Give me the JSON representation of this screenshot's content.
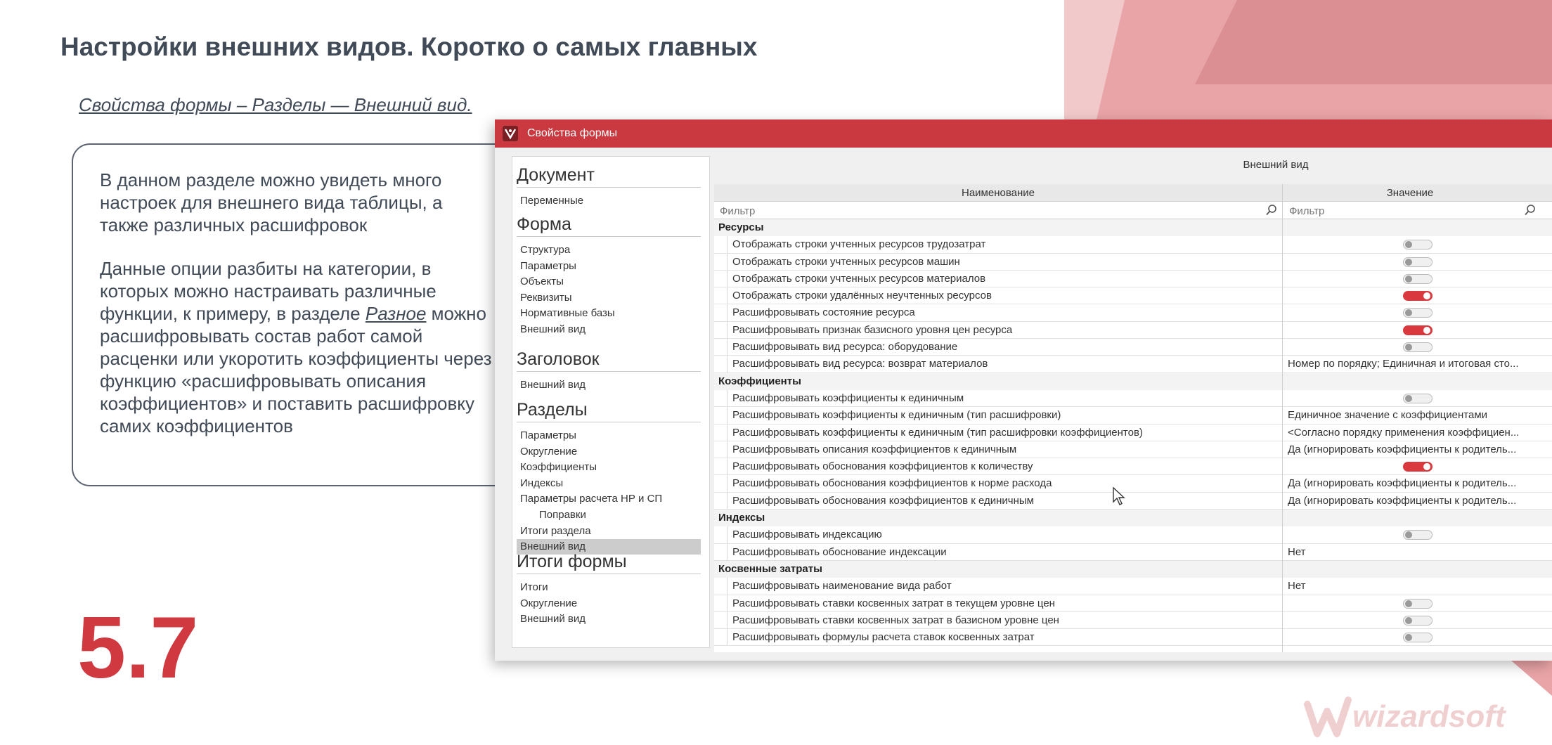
{
  "slide": {
    "title": "Настройки внешних видов. Коротко о самых главных",
    "breadcrumb": "Свойства формы – Разделы — Внешний вид.",
    "info_p1": "В данном разделе можно увидеть много настроек для внешнего вида таблицы, а также различных расшифровок",
    "info_p2_before": "Данные опции разбиты на категории, в которых можно настраивать различные функции, к примеру, в разделе ",
    "info_p2_link": "Разное",
    "info_p2_after": " можно расшифровывать состав работ самой расценки или укоротить коэффициенты через функцию «расшифровывать описания коэффициентов» и поставить расшифровку самих коэффициентов",
    "section_number": "5.7",
    "logo_text": "wizardsoft",
    "colors": {
      "accent": "#d0393f",
      "titlebar": "#c9393f",
      "text": "#414a57"
    }
  },
  "window": {
    "title": "Свойства формы",
    "icon": "app-icon",
    "panel_heading": "Внешний вид"
  },
  "nav": {
    "sections": [
      {
        "label": "Документ",
        "items": [
          "Переменные"
        ]
      },
      {
        "label": "Форма",
        "items": [
          "Структура",
          "Параметры",
          "Объекты",
          "Реквизиты",
          "Нормативные базы",
          "Внешний вид"
        ]
      },
      {
        "label": "Заголовок",
        "items": [
          "Внешний вид"
        ]
      },
      {
        "label": "Разделы",
        "items": [
          "Параметры",
          "Округление",
          "Коэффициенты",
          "Индексы",
          "Параметры расчета НР и СП",
          "Поправки",
          "Итоги раздела",
          "Внешний вид"
        ]
      },
      {
        "label": "Итоги формы",
        "items": [
          "Итоги",
          "Округление",
          "Внешний вид"
        ]
      }
    ],
    "selected": "Разделы / Внешний вид"
  },
  "grid": {
    "col_name": "Наименование",
    "col_value": "Значение",
    "filter_placeholder": "Фильтр",
    "categories": [
      {
        "name": "Ресурсы",
        "rows": [
          {
            "name": "Отображать строки учтенных ресурсов трудозатрат",
            "toggle": false
          },
          {
            "name": "Отображать строки учтенных ресурсов машин",
            "toggle": false
          },
          {
            "name": "Отображать строки учтенных ресурсов материалов",
            "toggle": false
          },
          {
            "name": "Отображать строки удалённых неучтенных ресурсов",
            "toggle": true
          },
          {
            "name": "Расшифровывать состояние ресурса",
            "toggle": false
          },
          {
            "name": "Расшифровывать признак базисного уровня цен ресурса",
            "toggle": true
          },
          {
            "name": "Расшифровывать вид ресурса: оборудование",
            "toggle": false
          },
          {
            "name": "Расшифровывать вид ресурса: возврат материалов",
            "value": "Номер по порядку; Единичная и итоговая сто..."
          }
        ]
      },
      {
        "name": "Коэффициенты",
        "rows": [
          {
            "name": "Расшифровывать коэффициенты к единичным",
            "toggle": false
          },
          {
            "name": "Расшифровывать коэффициенты к единичным (тип расшифровки)",
            "value": "Единичное значение с коэффициентами"
          },
          {
            "name": "Расшифровывать коэффициенты к единичным (тип расшифровки коэффициентов)",
            "value": "<Согласно порядку применения коэффициен..."
          },
          {
            "name": "Расшифровывать описания коэффициентов к единичным",
            "value": "Да (игнорировать коэффициенты к родитель..."
          },
          {
            "name": "Расшифровывать обоснования коэффициентов к количеству",
            "toggle": true
          },
          {
            "name": "Расшифровывать обоснования коэффициентов к норме расхода",
            "value": "Да (игнорировать коэффициенты к родитель..."
          },
          {
            "name": "Расшифровывать обоснования коэффициентов к единичным",
            "value": "Да (игнорировать коэффициенты к родитель..."
          }
        ]
      },
      {
        "name": "Индексы",
        "rows": [
          {
            "name": "Расшифровывать индексацию",
            "toggle": false
          },
          {
            "name": "Расшифровывать обоснование индексации",
            "value": "Нет"
          }
        ]
      },
      {
        "name": "Косвенные затраты",
        "rows": [
          {
            "name": "Расшифровывать наименование вида работ",
            "value": "Нет"
          },
          {
            "name": "Расшифровывать ставки косвенных затрат в текущем уровне цен",
            "toggle": false
          },
          {
            "name": "Расшифровывать ставки косвенных затрат в базисном уровне цен",
            "toggle": false
          },
          {
            "name": "Расшифровывать формулы расчета ставок косвенных затрат",
            "toggle": false
          }
        ]
      }
    ]
  }
}
